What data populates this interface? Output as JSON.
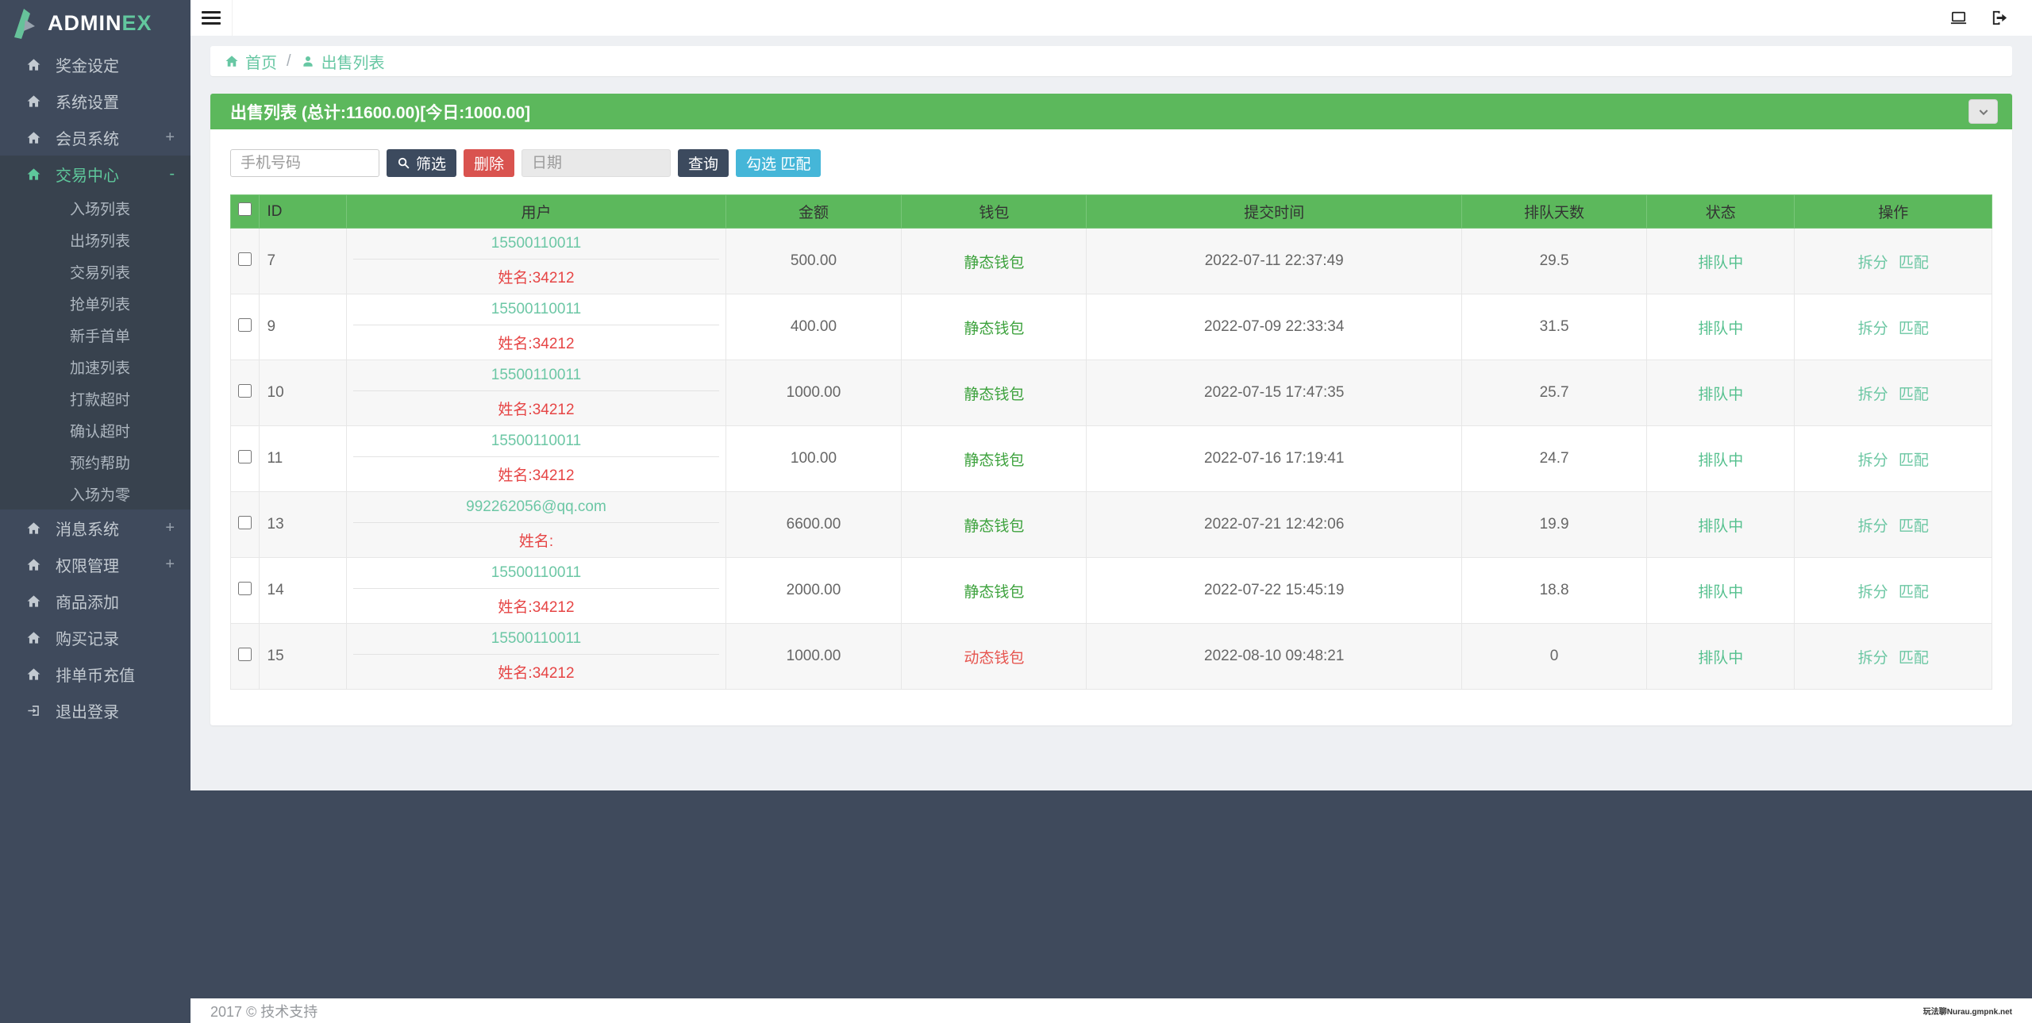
{
  "brand": {
    "logo_text": "ADMIN",
    "logo_accent": "EX"
  },
  "icons": {
    "menu": "hamburger three bars",
    "home": "house glyph",
    "sign_out": "arrow leaving bracket",
    "user": "person silhouette",
    "laptop": "laptop outline",
    "search": "magnifier",
    "chevron_down": "v chevron"
  },
  "colors": {
    "sidebar_bg": "#3f4a5c",
    "sidebar_active_bg": "#38424e",
    "accent_green": "#5cb85c",
    "mint_link": "#67c7a3",
    "navy_button": "#3c4a5e",
    "danger_button": "#d9534f",
    "info_button": "#45b6d8",
    "name_red": "#e64545",
    "wallet_green": "#3da23d",
    "wallet_red": "#e6554f",
    "status_green": "#55c08e"
  },
  "sidebar": {
    "items": [
      {
        "label": "奖金设定",
        "badge": ""
      },
      {
        "label": "系统设置",
        "badge": ""
      },
      {
        "label": "会员系统",
        "badge": "+"
      },
      {
        "label": "交易中心",
        "badge": "-"
      },
      {
        "label": "入场列表"
      },
      {
        "label": "出场列表"
      },
      {
        "label": "交易列表"
      },
      {
        "label": "抢单列表"
      },
      {
        "label": "新手首单"
      },
      {
        "label": "加速列表"
      },
      {
        "label": "打款超时"
      },
      {
        "label": "确认超时"
      },
      {
        "label": "预约帮助"
      },
      {
        "label": "入场为零"
      },
      {
        "label": "消息系统",
        "badge": "+"
      },
      {
        "label": "权限管理",
        "badge": "+"
      },
      {
        "label": "商品添加",
        "badge": ""
      },
      {
        "label": "购买记录",
        "badge": ""
      },
      {
        "label": "排单币充值",
        "badge": ""
      },
      {
        "label": "退出登录",
        "badge": ""
      }
    ]
  },
  "breadcrumb": {
    "home": "首页",
    "separator": "/",
    "current": "出售列表"
  },
  "panel": {
    "title": "出售列表 (总计:11600.00)[今日:1000.00]"
  },
  "filters": {
    "phone_placeholder": "手机号码",
    "filter_button": "筛选",
    "delete_button": "删除",
    "date_placeholder": "日期",
    "query_button": "查询",
    "match_button": "勾选 匹配"
  },
  "table": {
    "headers": [
      "ID",
      "用户",
      "金额",
      "钱包",
      "提交时间",
      "排队天数",
      "状态",
      "操作"
    ],
    "rows": [
      {
        "id": "7",
        "user": "15500110011",
        "name": "姓名:34212",
        "amount": "500.00",
        "wallet": "静态钱包",
        "wallet_class": "w-green",
        "time": "2022-07-11 22:37:49",
        "days": "29.5",
        "status": "排队中",
        "op_split": "拆分",
        "op_match": "匹配"
      },
      {
        "id": "9",
        "user": "15500110011",
        "name": "姓名:34212",
        "amount": "400.00",
        "wallet": "静态钱包",
        "wallet_class": "w-green",
        "time": "2022-07-09 22:33:34",
        "days": "31.5",
        "status": "排队中",
        "op_split": "拆分",
        "op_match": "匹配"
      },
      {
        "id": "10",
        "user": "15500110011",
        "name": "姓名:34212",
        "amount": "1000.00",
        "wallet": "静态钱包",
        "wallet_class": "w-green",
        "time": "2022-07-15 17:47:35",
        "days": "25.7",
        "status": "排队中",
        "op_split": "拆分",
        "op_match": "匹配"
      },
      {
        "id": "11",
        "user": "15500110011",
        "name": "姓名:34212",
        "amount": "100.00",
        "wallet": "静态钱包",
        "wallet_class": "w-green",
        "time": "2022-07-16 17:19:41",
        "days": "24.7",
        "status": "排队中",
        "op_split": "拆分",
        "op_match": "匹配"
      },
      {
        "id": "13",
        "user": "992262056@qq.com",
        "name": "姓名:",
        "amount": "6600.00",
        "wallet": "静态钱包",
        "wallet_class": "w-green",
        "time": "2022-07-21 12:42:06",
        "days": "19.9",
        "status": "排队中",
        "op_split": "拆分",
        "op_match": "匹配"
      },
      {
        "id": "14",
        "user": "15500110011",
        "name": "姓名:34212",
        "amount": "2000.00",
        "wallet": "静态钱包",
        "wallet_class": "w-green",
        "time": "2022-07-22 15:45:19",
        "days": "18.8",
        "status": "排队中",
        "op_split": "拆分",
        "op_match": "匹配"
      },
      {
        "id": "15",
        "user": "15500110011",
        "name": "姓名:34212",
        "amount": "1000.00",
        "wallet": "动态钱包",
        "wallet_class": "w-red",
        "time": "2022-08-10 09:48:21",
        "days": "0",
        "status": "排队中",
        "op_split": "拆分",
        "op_match": "匹配"
      }
    ]
  },
  "footer": {
    "left": "2017 © 技术支持",
    "right": "玩法聊Nurau.gmpnk.net"
  }
}
